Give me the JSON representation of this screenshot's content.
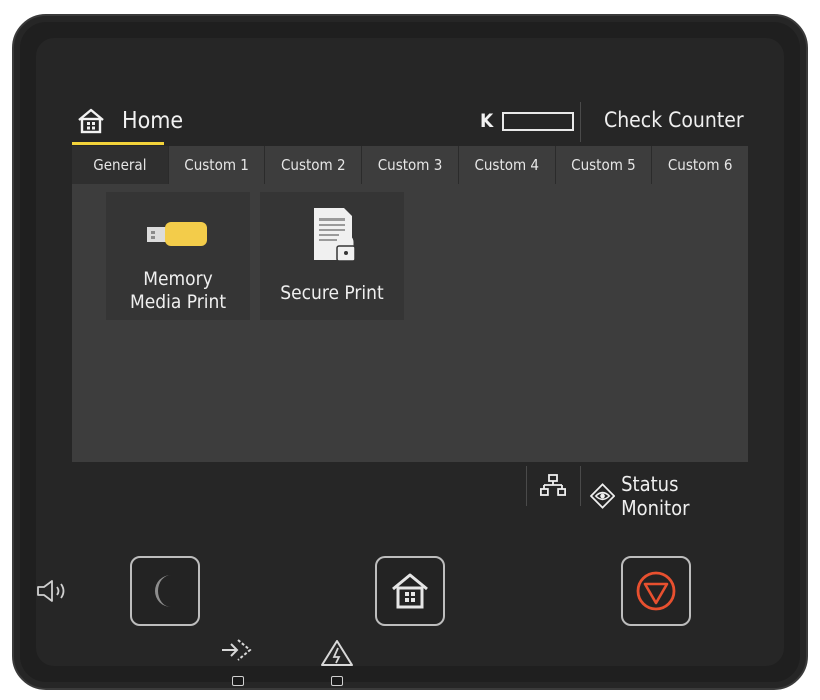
{
  "header": {
    "home_label": "Home",
    "toner_label": "K",
    "check_counter": "Check Counter"
  },
  "tabs": [
    {
      "label": "General",
      "active": true
    },
    {
      "label": "Custom 1"
    },
    {
      "label": "Custom 2"
    },
    {
      "label": "Custom 3"
    },
    {
      "label": "Custom 4"
    },
    {
      "label": "Custom 5"
    },
    {
      "label": "Custom 6"
    }
  ],
  "tiles": [
    {
      "line1": "Memory",
      "line2": "Media Print",
      "icon": "usb-drive-icon"
    },
    {
      "label": "Secure Print",
      "icon": "secure-document-icon"
    }
  ],
  "status_bar": {
    "network_icon": "network-icon",
    "status_monitor": "Status Monitor",
    "status_icon": "eye-icon"
  },
  "hardware": {
    "buttons": [
      "sleep-icon",
      "home-icon",
      "stop-icon"
    ],
    "indicators": [
      "speaker-icon",
      "data-indicator-icon",
      "error-indicator-icon"
    ]
  },
  "colors": {
    "accent": "#f3d33a",
    "usb": "#f3cc4a",
    "stop": "#e8502f"
  }
}
